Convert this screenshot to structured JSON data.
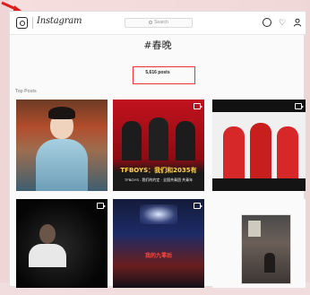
{
  "header": {
    "wordmark": "Instagram",
    "search_placeholder": "Search"
  },
  "tag": {
    "title": "#春晚",
    "post_count": "5,616 posts"
  },
  "section_label": "Top Posts",
  "posts": [
    {
      "caption": ""
    },
    {
      "caption": "TFBOYS：我们和2035有",
      "subcaption": "TFBOYS - 我们的约定 · 全国共青团 共青年"
    },
    {
      "caption": ""
    },
    {
      "caption": ""
    },
    {
      "caption": "我的九零后"
    },
    {
      "caption": ""
    }
  ],
  "colors": {
    "highlight_box": "#e33333",
    "text": "#262626",
    "muted": "#999999"
  }
}
